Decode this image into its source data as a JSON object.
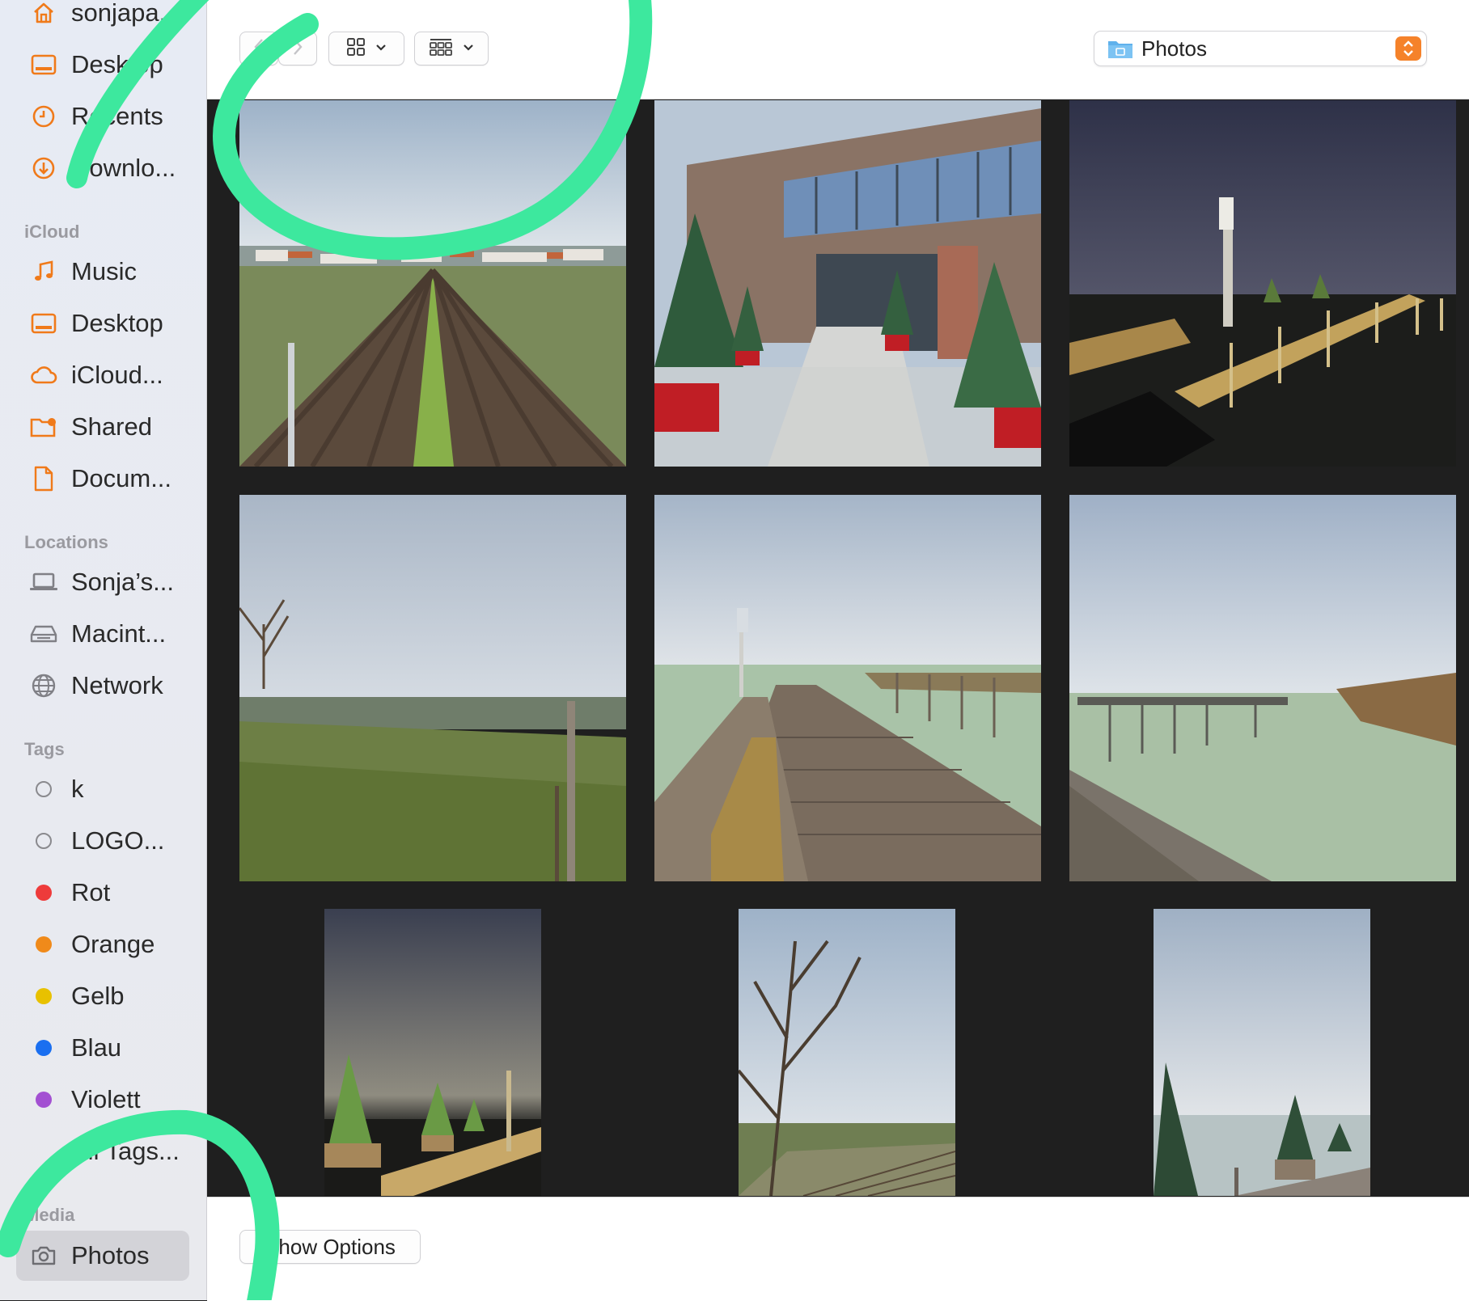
{
  "sidebar": {
    "favorites": [
      {
        "label": "sonjapa...",
        "icon": "home-icon"
      },
      {
        "label": "Desktop",
        "icon": "desktop-icon"
      },
      {
        "label": "Recents",
        "icon": "clock-icon"
      },
      {
        "label": "Downlo...",
        "icon": "download-icon"
      }
    ],
    "icloud_header": "iCloud",
    "icloud": [
      {
        "label": "Music",
        "icon": "music-note-icon"
      },
      {
        "label": "Desktop",
        "icon": "desktop-icon"
      },
      {
        "label": "iCloud...",
        "icon": "cloud-icon"
      },
      {
        "label": "Shared",
        "icon": "shared-folder-icon"
      },
      {
        "label": "Docum...",
        "icon": "document-icon"
      }
    ],
    "locations_header": "Locations",
    "locations": [
      {
        "label": "Sonja’s...",
        "icon": "laptop-icon"
      },
      {
        "label": "Macint...",
        "icon": "disk-icon"
      },
      {
        "label": "Network",
        "icon": "globe-icon"
      }
    ],
    "tags_header": "Tags",
    "tags": [
      {
        "label": "k",
        "color": "none"
      },
      {
        "label": "LOGO...",
        "color": "none"
      },
      {
        "label": "Rot",
        "color": "#ee3b3b"
      },
      {
        "label": "Orange",
        "color": "#f08a1a"
      },
      {
        "label": "Gelb",
        "color": "#e8c100"
      },
      {
        "label": "Blau",
        "color": "#1a6ff0"
      },
      {
        "label": "Violett",
        "color": "#a350d2"
      },
      {
        "label": "All Tags...",
        "color": "none"
      }
    ],
    "media_header": "Media",
    "media": [
      {
        "label": "Photos",
        "icon": "camera-icon",
        "selected": true
      }
    ]
  },
  "toolbar": {
    "back_icon": "chevron-left-icon",
    "forward_icon": "chevron-right-icon",
    "view_icon": "grid-view-icon",
    "group_icon": "group-grid-icon",
    "location_label": "Photos",
    "location_icon": "photos-folder-icon",
    "accent": "#f5822a"
  },
  "photos": [
    {
      "subject": "vineyard-rows"
    },
    {
      "subject": "building-christmas-trees"
    },
    {
      "subject": "pier-night"
    },
    {
      "subject": "hill-meadow"
    },
    {
      "subject": "wooden-pier-lake"
    },
    {
      "subject": "lake-jetty-reeds"
    },
    {
      "subject": "pier-night-trees"
    },
    {
      "subject": "bare-tree-vineyard"
    },
    {
      "subject": "lake-trees-pier"
    }
  ],
  "footer": {
    "options_label": "Show Options"
  },
  "annotation_color": "#3de89e"
}
